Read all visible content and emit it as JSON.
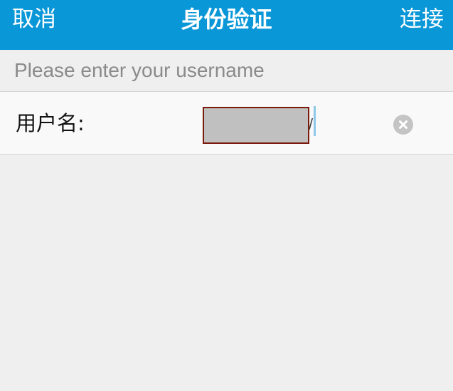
{
  "nav": {
    "cancel_label": "取消",
    "title": "身份验证",
    "connect_label": "连接"
  },
  "form": {
    "section_hint": "Please enter your username",
    "username_label": "用户名:",
    "username_value": ""
  },
  "icons": {
    "clear": "clear-icon"
  },
  "colors": {
    "nav_background": "#0a97d8",
    "page_background": "#efefef",
    "redaction_border": "#7a1a0c"
  }
}
